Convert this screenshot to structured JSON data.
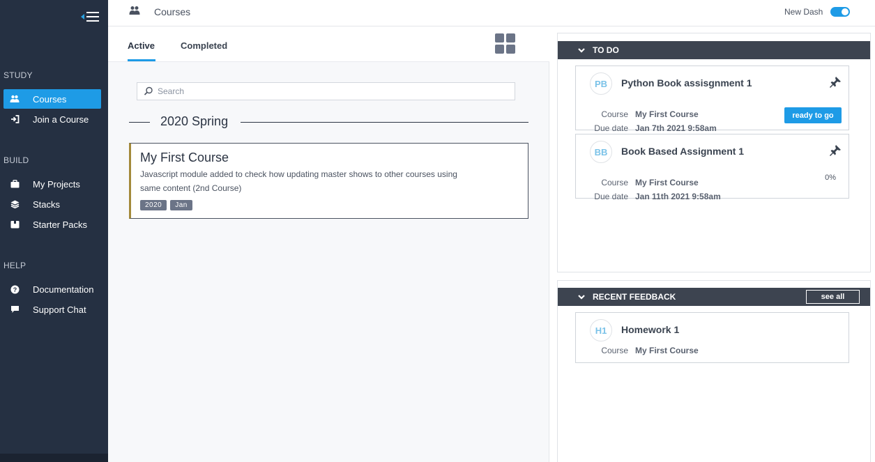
{
  "sidebar": {
    "sections": [
      {
        "title": "STUDY"
      },
      {
        "title": "BUILD"
      },
      {
        "title": "HELP"
      }
    ],
    "items": [
      {
        "label": "Courses",
        "icon": "users-icon",
        "active": true
      },
      {
        "label": "Join a Course",
        "icon": "sign-in-icon"
      },
      {
        "label": "My Projects",
        "icon": "briefcase-icon"
      },
      {
        "label": "Stacks",
        "icon": "layers-icon"
      },
      {
        "label": "Starter Packs",
        "icon": "box-icon"
      },
      {
        "label": "Documentation",
        "icon": "question-circle-icon"
      },
      {
        "label": "Support Chat",
        "icon": "chat-bubble-icon"
      }
    ]
  },
  "header": {
    "title": "Courses",
    "new_dash_label": "New Dash",
    "new_dash_enabled": true
  },
  "tabs": [
    {
      "label": "Active",
      "active": true
    },
    {
      "label": "Completed",
      "active": false
    }
  ],
  "search": {
    "placeholder": "Search",
    "value": ""
  },
  "season": {
    "label": "2020 Spring"
  },
  "course": {
    "title": "My First Course",
    "description": "Javascript module added to check how updating master shows to other courses using same content (2nd Course)",
    "tags": [
      "2020",
      "Jan"
    ]
  },
  "todo": {
    "title": "TO DO",
    "items": [
      {
        "initials": "PB",
        "title": "Python Book assisgnment 1",
        "course_label": "Course",
        "course": "My First Course",
        "due_label": "Due date",
        "due": "Jan 7th 2021 9:58am",
        "status": "ready to go"
      },
      {
        "initials": "BB",
        "title": "Book Based Assignment 1",
        "course_label": "Course",
        "course": "My First Course",
        "due_label": "Due date",
        "due": "Jan 11th 2021 9:58am",
        "progress": "0%"
      }
    ]
  },
  "feedback": {
    "title": "RECENT FEEDBACK",
    "see_all_label": "see all",
    "items": [
      {
        "initials": "H1",
        "title": "Homework 1",
        "course_label": "Course",
        "course": "My First Course"
      }
    ]
  },
  "colors": {
    "sidebar_bg": "#253042",
    "accent": "#1e9be6",
    "panel_header": "#3d4450",
    "card_accent": "#a38a3a"
  }
}
